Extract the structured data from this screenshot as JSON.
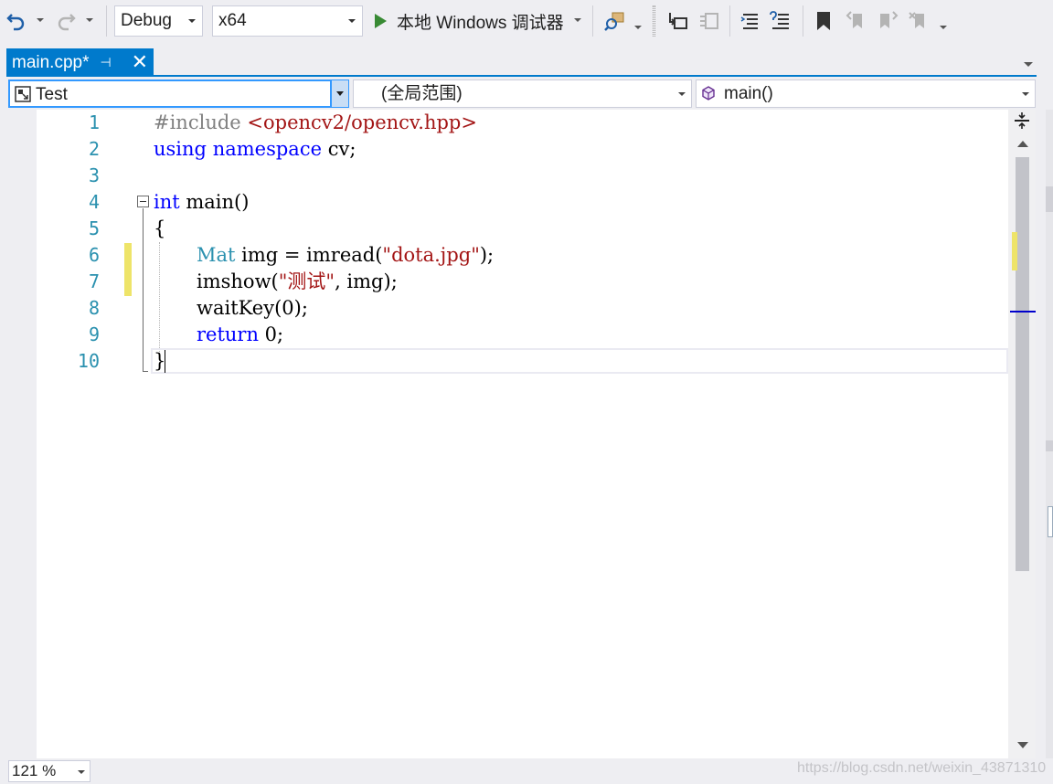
{
  "toolbar": {
    "config": "Debug",
    "platform": "x64",
    "run_label": "本地 Windows 调试器"
  },
  "tab": {
    "title": "main.cpp*",
    "pin_glyph": "⊣",
    "close_glyph": "✕"
  },
  "navbar": {
    "project": "Test",
    "scope": "(全局范围)",
    "member": "main()"
  },
  "editor": {
    "line_numbers": [
      "1",
      "2",
      "3",
      "4",
      "5",
      "6",
      "7",
      "8",
      "9",
      "10"
    ],
    "code": {
      "l1_directive": "#include",
      "l1_header": "<opencv2/opencv.hpp>",
      "l2_using": "using",
      "l2_namespace": "namespace",
      "l2_rest": " cv;",
      "l4_type": "int",
      "l4_rest": " main()",
      "l5": "{",
      "l6_type": "Mat",
      "l6_mid": " img = imread(",
      "l6_str": "\"dota.jpg\"",
      "l6_end": ");",
      "l7_start": "imshow(",
      "l7_str": "\"测试\"",
      "l7_end": ", img);",
      "l8": "waitKey(0);",
      "l9_kw": "return",
      "l9_rest": " 0;",
      "l10": "}"
    }
  },
  "status": {
    "zoom": "121 %",
    "watermark": "https://blog.csdn.net/weixin_43871310"
  },
  "colors": {
    "accent": "#007acc",
    "keyword": "#0000ff",
    "type": "#2b91af",
    "string": "#a31515",
    "preprocessor": "#808080",
    "change_marker": "#eee469"
  }
}
